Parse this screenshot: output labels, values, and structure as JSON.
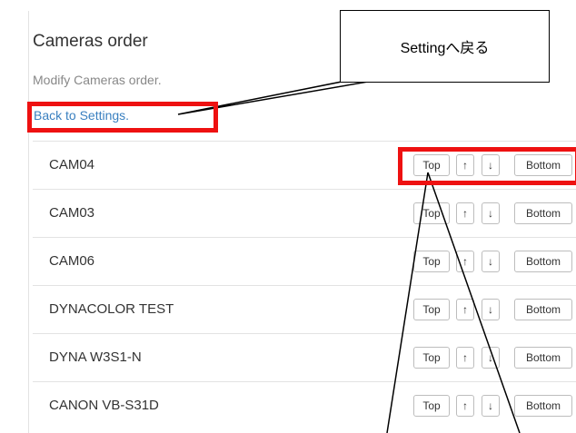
{
  "page": {
    "title": "Cameras order",
    "subtitle": "Modify Cameras order.",
    "back_link": "Back to Settings."
  },
  "buttons": {
    "top": "Top",
    "up": "↑",
    "down": "↓",
    "bottom": "Bottom"
  },
  "cameras": [
    {
      "name": "CAM04"
    },
    {
      "name": "CAM03"
    },
    {
      "name": "CAM06"
    },
    {
      "name": "DYNACOLOR TEST"
    },
    {
      "name": "DYNA W3S1-N"
    },
    {
      "name": "CANON VB-S31D"
    }
  ],
  "annotation": {
    "callout_text": "Settingへ戻る",
    "highlight_color": "#ee1111"
  },
  "colors": {
    "link": "#3a80c0",
    "muted": "#888888",
    "border": "#e3e3e3"
  }
}
